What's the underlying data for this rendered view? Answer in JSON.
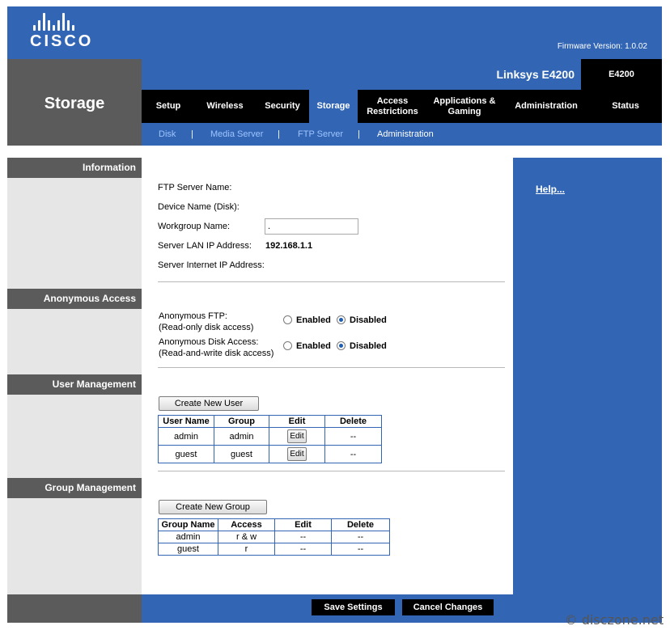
{
  "header": {
    "logo_text": "CISCO",
    "firmware": "Firmware Version: 1.0.02"
  },
  "page_title": "Storage",
  "model": {
    "name": "Linksys E4200",
    "code": "E4200"
  },
  "nav": {
    "tabs": [
      {
        "l1": "Setup",
        "l2": ""
      },
      {
        "l1": "Wireless",
        "l2": ""
      },
      {
        "l1": "Security",
        "l2": ""
      },
      {
        "l1": "Storage",
        "l2": ""
      },
      {
        "l1": "Access",
        "l2": "Restrictions"
      },
      {
        "l1": "Applications &",
        "l2": "Gaming"
      },
      {
        "l1": "Administration",
        "l2": ""
      },
      {
        "l1": "Status",
        "l2": ""
      }
    ],
    "subtabs": [
      "Disk",
      "Media Server",
      "FTP Server",
      "Administration"
    ],
    "separator": "|"
  },
  "sections": {
    "information": "Information",
    "anonymous": "Anonymous Access",
    "users": "User Management",
    "groups": "Group Management"
  },
  "info": {
    "ftp_server_name": "FTP Server Name:",
    "device_name": "Device Name (Disk):",
    "workgroup_name": "Workgroup Name:",
    "workgroup_value": ".",
    "server_lan_ip": "Server LAN IP Address:",
    "server_lan_ip_value": "192.168.1.1",
    "server_internet_ip": "Server Internet IP Address:"
  },
  "anon": {
    "ftp_label1": "Anonymous FTP:",
    "ftp_label2": "(Read-only disk access)",
    "disk_label1": "Anonymous Disk Access:",
    "disk_label2": "(Read-and-write disk access)",
    "enabled": "Enabled",
    "disabled": "Disabled"
  },
  "users": {
    "create_button": "Create New User",
    "headers": [
      "User Name",
      "Group",
      "Edit",
      "Delete"
    ],
    "rows": [
      {
        "name": "admin",
        "group": "admin",
        "edit": "Edit",
        "delete": "--"
      },
      {
        "name": "guest",
        "group": "guest",
        "edit": "Edit",
        "delete": "--"
      }
    ]
  },
  "groups": {
    "create_button": "Create New Group",
    "headers": [
      "Group Name",
      "Access",
      "Edit",
      "Delete"
    ],
    "rows": [
      {
        "name": "admin",
        "access": "r & w",
        "edit": "--",
        "delete": "--"
      },
      {
        "name": "guest",
        "access": "r",
        "edit": "--",
        "delete": "--"
      }
    ]
  },
  "help": "Help...",
  "footer": {
    "save": "Save Settings",
    "cancel": "Cancel Changes"
  },
  "watermark": "© disczone.net"
}
